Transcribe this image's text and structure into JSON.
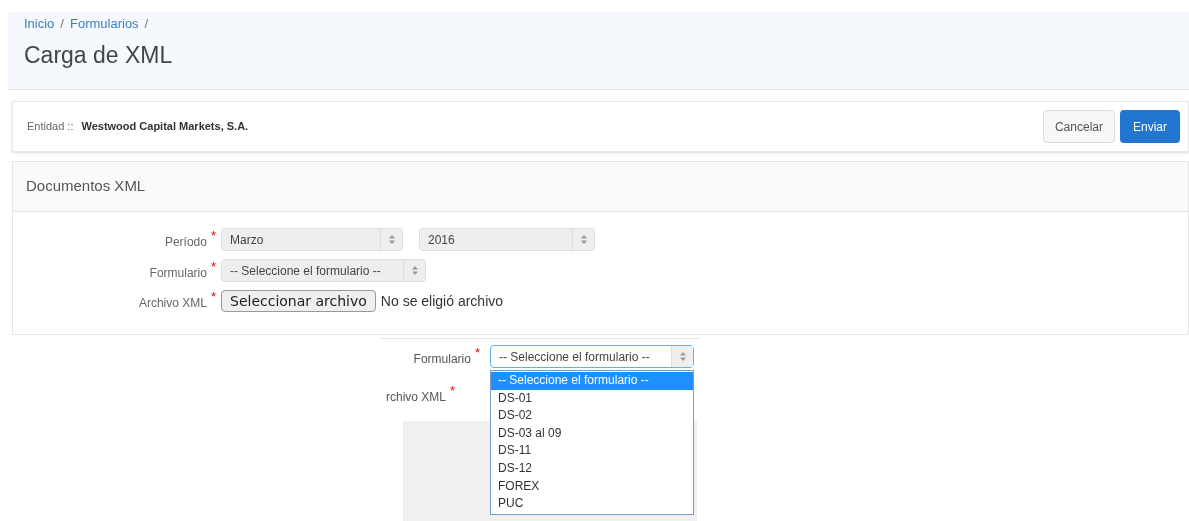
{
  "breadcrumb": {
    "separator": "/",
    "items": [
      {
        "label": "Inicio"
      },
      {
        "label": "Formularios"
      }
    ]
  },
  "title": "Carga de XML",
  "entity": {
    "label": "Entidad ::",
    "value": "Westwood Capital Markets, S.A."
  },
  "actions": [
    {
      "label": "Cancelar",
      "kind": "default"
    },
    {
      "label": "Enviar",
      "kind": "primary"
    }
  ],
  "required_mark": "*",
  "panel": {
    "title": "Documentos XML",
    "fields": [
      {
        "label": "Período",
        "required": true,
        "kind": "selects",
        "values": [
          "Marzo",
          "2016"
        ]
      },
      {
        "label": "Formulario",
        "required": true,
        "kind": "select",
        "values": [
          "-- Seleccione el formulario --"
        ]
      },
      {
        "label": "Archivo XML",
        "required": true,
        "kind": "file",
        "button": "Seleccionar archivo",
        "status": "No se eligió archivo"
      }
    ]
  },
  "inset": {
    "label": "Formulario",
    "required": true,
    "value": "-- Seleccione el formulario --",
    "next_label": "rchivo XML",
    "next_required": true,
    "options": [
      {
        "label": "-- Seleccione el formulario --",
        "selected": true
      },
      {
        "label": "DS-01",
        "selected": false
      },
      {
        "label": "DS-02",
        "selected": false
      },
      {
        "label": "DS-03 al 09",
        "selected": false
      },
      {
        "label": "DS-11",
        "selected": false
      },
      {
        "label": "DS-12",
        "selected": false
      },
      {
        "label": "FOREX",
        "selected": false
      },
      {
        "label": "PUC",
        "selected": false
      }
    ]
  }
}
